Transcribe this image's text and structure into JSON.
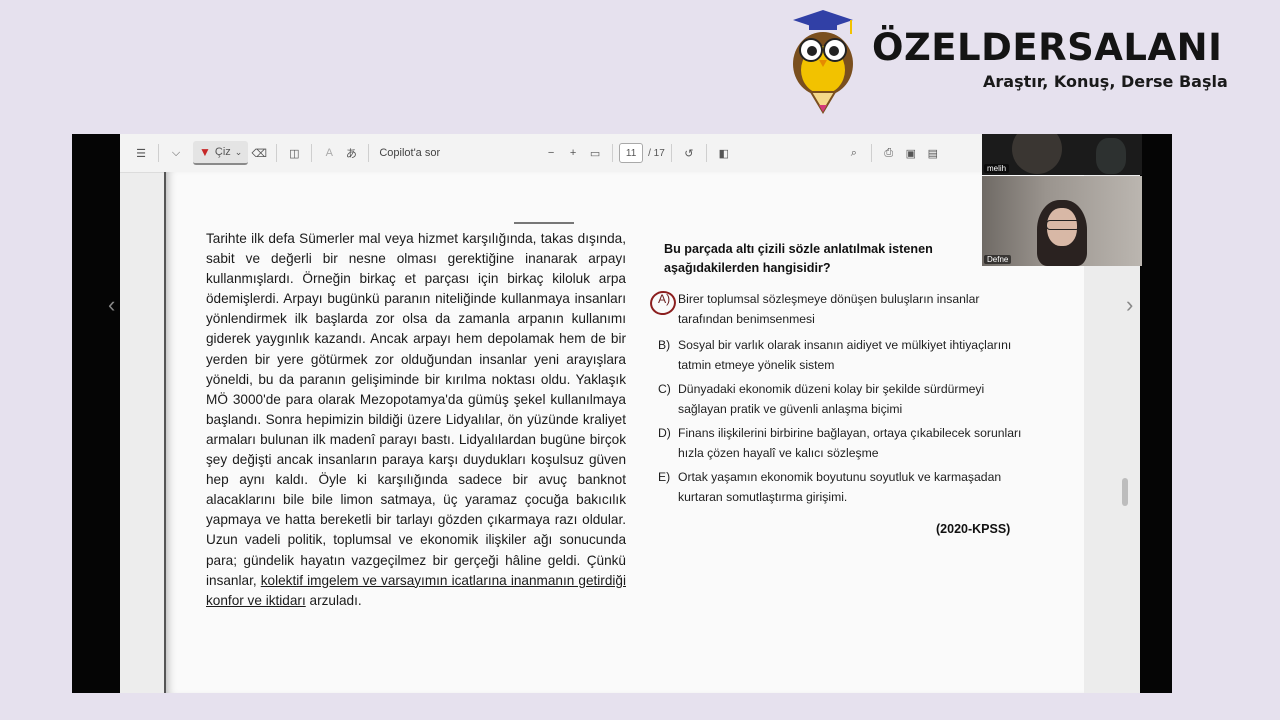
{
  "brand": {
    "name": "ÖZELDERSALANI",
    "slogan": "Araştır, Konuş, Derse Başla"
  },
  "toolbar": {
    "draw_label": "Çiz",
    "copilot_label": "Copilot'a sor",
    "current_page": "11",
    "total_pages": "/ 17"
  },
  "passage": {
    "text_before": "Tarihte ilk defa Sümerler mal veya hizmet karşılığında, takas dışında, sabit ve değerli bir nesne olması gerektiğine inanarak arpayı kullanmışlardı. Örneğin birkaç et parçası için birkaç kiloluk arpa ödemişlerdi. Arpayı bugünkü paranın niteliğinde kullanmaya insanları yönlendirmek ilk başlarda zor olsa da zamanla arpanın kullanımı giderek yaygınlık kazandı. Ancak arpayı hem depolamak hem de bir yerden bir yere götürmek zor olduğundan insanlar yeni arayışlara yöneldi, bu da paranın gelişiminde bir kırılma noktası oldu. Yaklaşık MÖ 3000'de para olarak Mezopotamya'da gümüş şekel kullanılmaya başlandı. Sonra hepimizin bildiği üzere Lidyalılar, ön yüzünde kraliyet armaları bulunan ilk madenî parayı bastı. Lidyalılardan bugüne birçok şey değişti ancak insanların paraya karşı duydukları koşulsuz güven hep aynı kaldı. Öyle ki karşılığında sadece bir avuç banknot alacaklarını bile bile limon satmaya, üç yaramaz çocuğa bakıcılık yapmaya ve hatta bereketli bir tarlayı gözden çıkarmaya razı oldular. Uzun vadeli politik, toplumsal ve ekonomik ilişkiler ağı sonucunda para; gündelik hayatın vazgeçilmez bir gerçeği hâline geldi. Çünkü insanlar,",
    "underlined": "kolektif imgelem ve varsayımın icatlarına inanmanın getirdiği konfor ve iktidarı",
    "text_after": "arzuladı."
  },
  "question": {
    "stem": "Bu parçada altı çizili sözle anlatılmak istenen aşağıdakilerden hangisidir?",
    "options": [
      {
        "letter": "A)",
        "text": "Birer toplumsal sözleşmeye dönüşen buluşların insanlar tarafından benimsenmesi"
      },
      {
        "letter": "B)",
        "text": "Sosyal bir varlık olarak insanın aidiyet ve mülkiyet ihtiyaçlarını tatmin etmeye yönelik sistem"
      },
      {
        "letter": "C)",
        "text": "Dünyadaki ekonomik düzeni kolay bir şekilde sürdürmeyi sağlayan pratik ve güvenli anlaşma biçimi"
      },
      {
        "letter": "D)",
        "text": "Finans ilişkilerini birbirine bağlayan, ortaya çıkabilecek sorunları hızla çözen hayalî ve kalıcı sözleşme"
      },
      {
        "letter": "E)",
        "text": "Ortak yaşamın ekonomik boyutunu soyutluk ve karmaşadan kurtaran somutlaştırma girişimi."
      }
    ],
    "source": "(2020-KPSS)"
  },
  "webcams": [
    {
      "name": "melih"
    },
    {
      "name": "Defne"
    }
  ]
}
